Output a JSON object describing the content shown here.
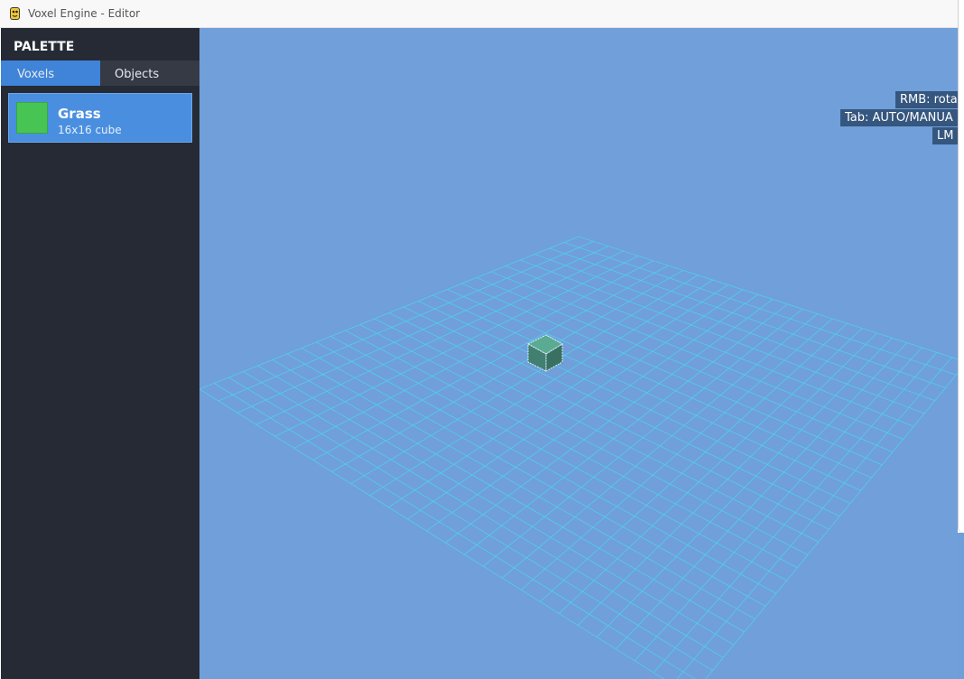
{
  "window": {
    "title": "Voxel Engine - Editor",
    "icon": "python-snake-icon"
  },
  "sidebar": {
    "title": "PALETTE",
    "tabs": [
      {
        "label": "Voxels",
        "active": true
      },
      {
        "label": "Objects",
        "active": false
      }
    ],
    "items": [
      {
        "name": "Grass",
        "description": "16x16 cube",
        "color": "#46c555",
        "selected": true
      }
    ]
  },
  "viewport": {
    "background": "#709fd9",
    "grid_color": "#4fd0f2",
    "hints": [
      {
        "text": "RMB: rota"
      },
      {
        "text": "Tab: AUTO/MANUA"
      },
      {
        "text": "LM"
      }
    ],
    "cube_color": "#4f9a86"
  },
  "colors": {
    "sidebar_bg": "#262a34",
    "accent": "#3f84d8"
  }
}
